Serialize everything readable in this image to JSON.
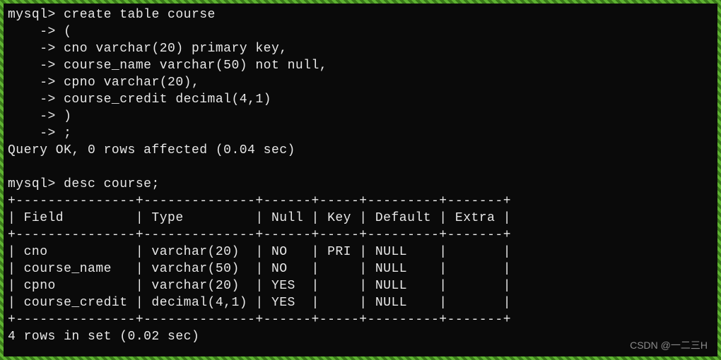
{
  "prompt": "mysql>",
  "continuation": "    ->",
  "create_stmt": {
    "line1": "create table course",
    "line2": "(",
    "line3": "cno varchar(20) primary key,",
    "line4": "course_name varchar(50) not null,",
    "line5": "cpno varchar(20),",
    "line6": "course_credit decimal(4,1)",
    "line7": ")",
    "line8": ";"
  },
  "query_ok": "Query OK, 0 rows affected (0.04 sec)",
  "desc_cmd": "desc course;",
  "table": {
    "border": "+---------------+--------------+------+-----+---------+-------+",
    "header": "| Field         | Type         | Null | Key | Default | Extra |",
    "rows": [
      "| cno           | varchar(20)  | NO   | PRI | NULL    |       |",
      "| course_name   | varchar(50)  | NO   |     | NULL    |       |",
      "| cpno          | varchar(20)  | YES  |     | NULL    |       |",
      "| course_credit | decimal(4,1) | YES  |     | NULL    |       |"
    ]
  },
  "rows_msg": "4 rows in set (0.02 sec)",
  "watermark": "CSDN @一二三H",
  "chart_data": {
    "type": "table",
    "title": "desc course",
    "columns": [
      "Field",
      "Type",
      "Null",
      "Key",
      "Default",
      "Extra"
    ],
    "rows": [
      [
        "cno",
        "varchar(20)",
        "NO",
        "PRI",
        "NULL",
        ""
      ],
      [
        "course_name",
        "varchar(50)",
        "NO",
        "",
        "NULL",
        ""
      ],
      [
        "cpno",
        "varchar(20)",
        "YES",
        "",
        "NULL",
        ""
      ],
      [
        "course_credit",
        "decimal(4,1)",
        "YES",
        "",
        "NULL",
        ""
      ]
    ]
  }
}
